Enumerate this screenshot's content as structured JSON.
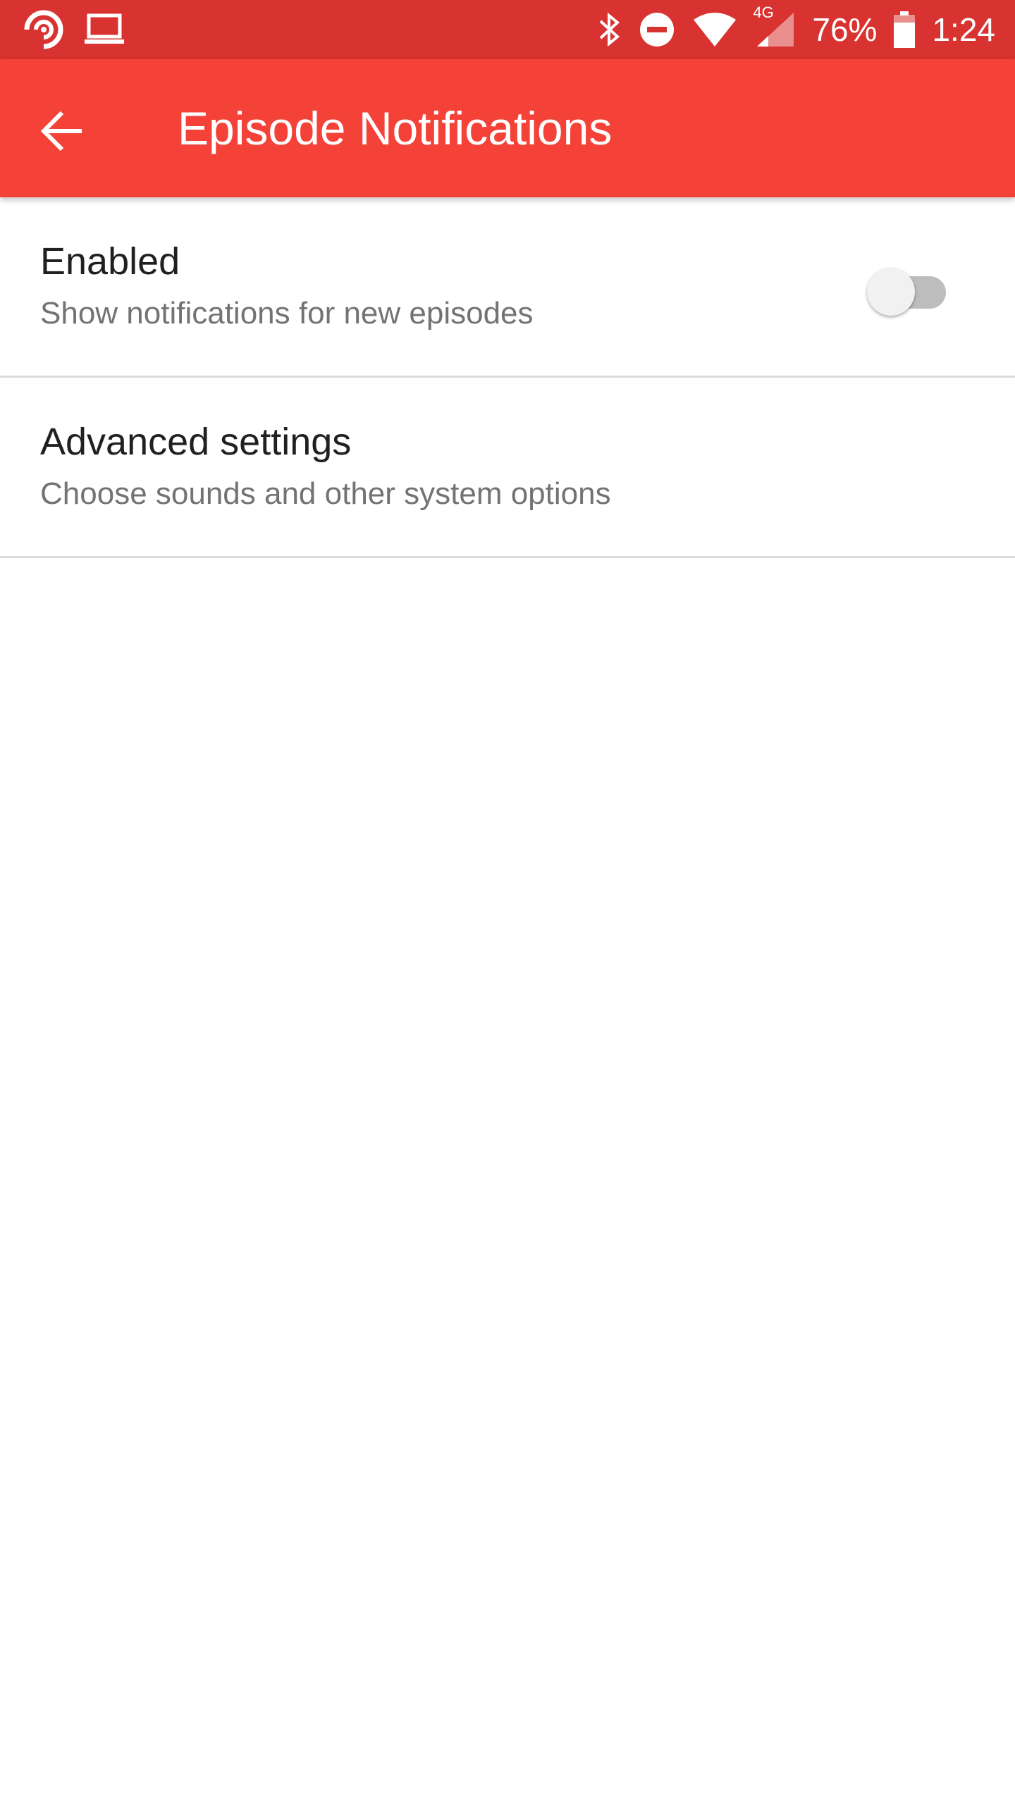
{
  "status_bar": {
    "battery_percent": "76%",
    "time": "1:24",
    "network_type": "4G",
    "icons_left": [
      "pocket-casts-icon",
      "laptop-icon"
    ],
    "icons_right": [
      "bluetooth-icon",
      "do-not-disturb-icon",
      "wifi-icon",
      "cellular-signal-icon",
      "battery-icon"
    ],
    "background_color": "#d83330"
  },
  "app_bar": {
    "title": "Episode Notifications",
    "back_icon": "arrow-back-icon",
    "background_color": "#f44239"
  },
  "settings": [
    {
      "title": "Enabled",
      "summary": "Show notifications for new episodes",
      "toggle": {
        "checked": false
      }
    },
    {
      "title": "Advanced settings",
      "summary": "Choose sounds and other system options"
    }
  ]
}
